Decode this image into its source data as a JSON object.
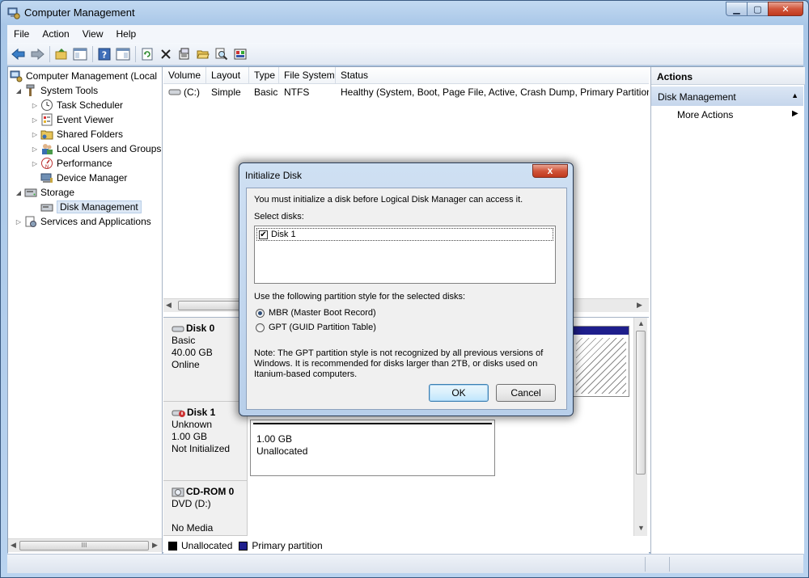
{
  "window": {
    "title": "Computer Management"
  },
  "menu": [
    "File",
    "Action",
    "View",
    "Help"
  ],
  "tree": {
    "root": "Computer Management (Local",
    "system_tools": "System Tools",
    "task_scheduler": "Task Scheduler",
    "event_viewer": "Event Viewer",
    "shared_folders": "Shared Folders",
    "local_users": "Local Users and Groups",
    "performance": "Performance",
    "device_manager": "Device Manager",
    "storage": "Storage",
    "disk_management": "Disk Management",
    "services": "Services and Applications",
    "scroll_grip": "III"
  },
  "volume_table": {
    "columns": [
      "Volume",
      "Layout",
      "Type",
      "File System",
      "Status"
    ],
    "rows": [
      {
        "volume": "(C:)",
        "layout": "Simple",
        "type": "Basic",
        "fs": "NTFS",
        "status": "Healthy (System, Boot, Page File, Active, Crash Dump, Primary Partition"
      }
    ]
  },
  "disks": [
    {
      "name": "Disk 0",
      "kind": "Basic",
      "size": "40.00 GB",
      "state": "Online"
    },
    {
      "name": "Disk 1",
      "kind": "Unknown",
      "size": "1.00 GB",
      "state": "Not Initialized",
      "partition_size": "1.00 GB",
      "partition_state": "Unallocated"
    },
    {
      "name": "CD-ROM 0",
      "kind": "DVD (D:)",
      "state": "No Media"
    }
  ],
  "legend": {
    "unallocated": "Unallocated",
    "primary": "Primary partition",
    "unallocated_color": "#000000",
    "primary_color": "#1e1e8c"
  },
  "actions": {
    "header": "Actions",
    "section": "Disk Management",
    "more": "More Actions"
  },
  "dialog": {
    "title": "Initialize Disk",
    "close": "x",
    "intro": "You must initialize a disk before Logical Disk Manager can access it.",
    "select_label": "Select disks:",
    "disk_item": "Disk 1",
    "style_label": "Use the following partition style for the selected disks:",
    "mbr": "MBR (Master Boot Record)",
    "gpt": "GPT (GUID Partition Table)",
    "note": "Note: The GPT partition style is not recognized by all previous versions of Windows. It is recommended for disks larger than 2TB, or disks used on Itanium-based computers.",
    "ok": "OK",
    "cancel": "Cancel"
  }
}
